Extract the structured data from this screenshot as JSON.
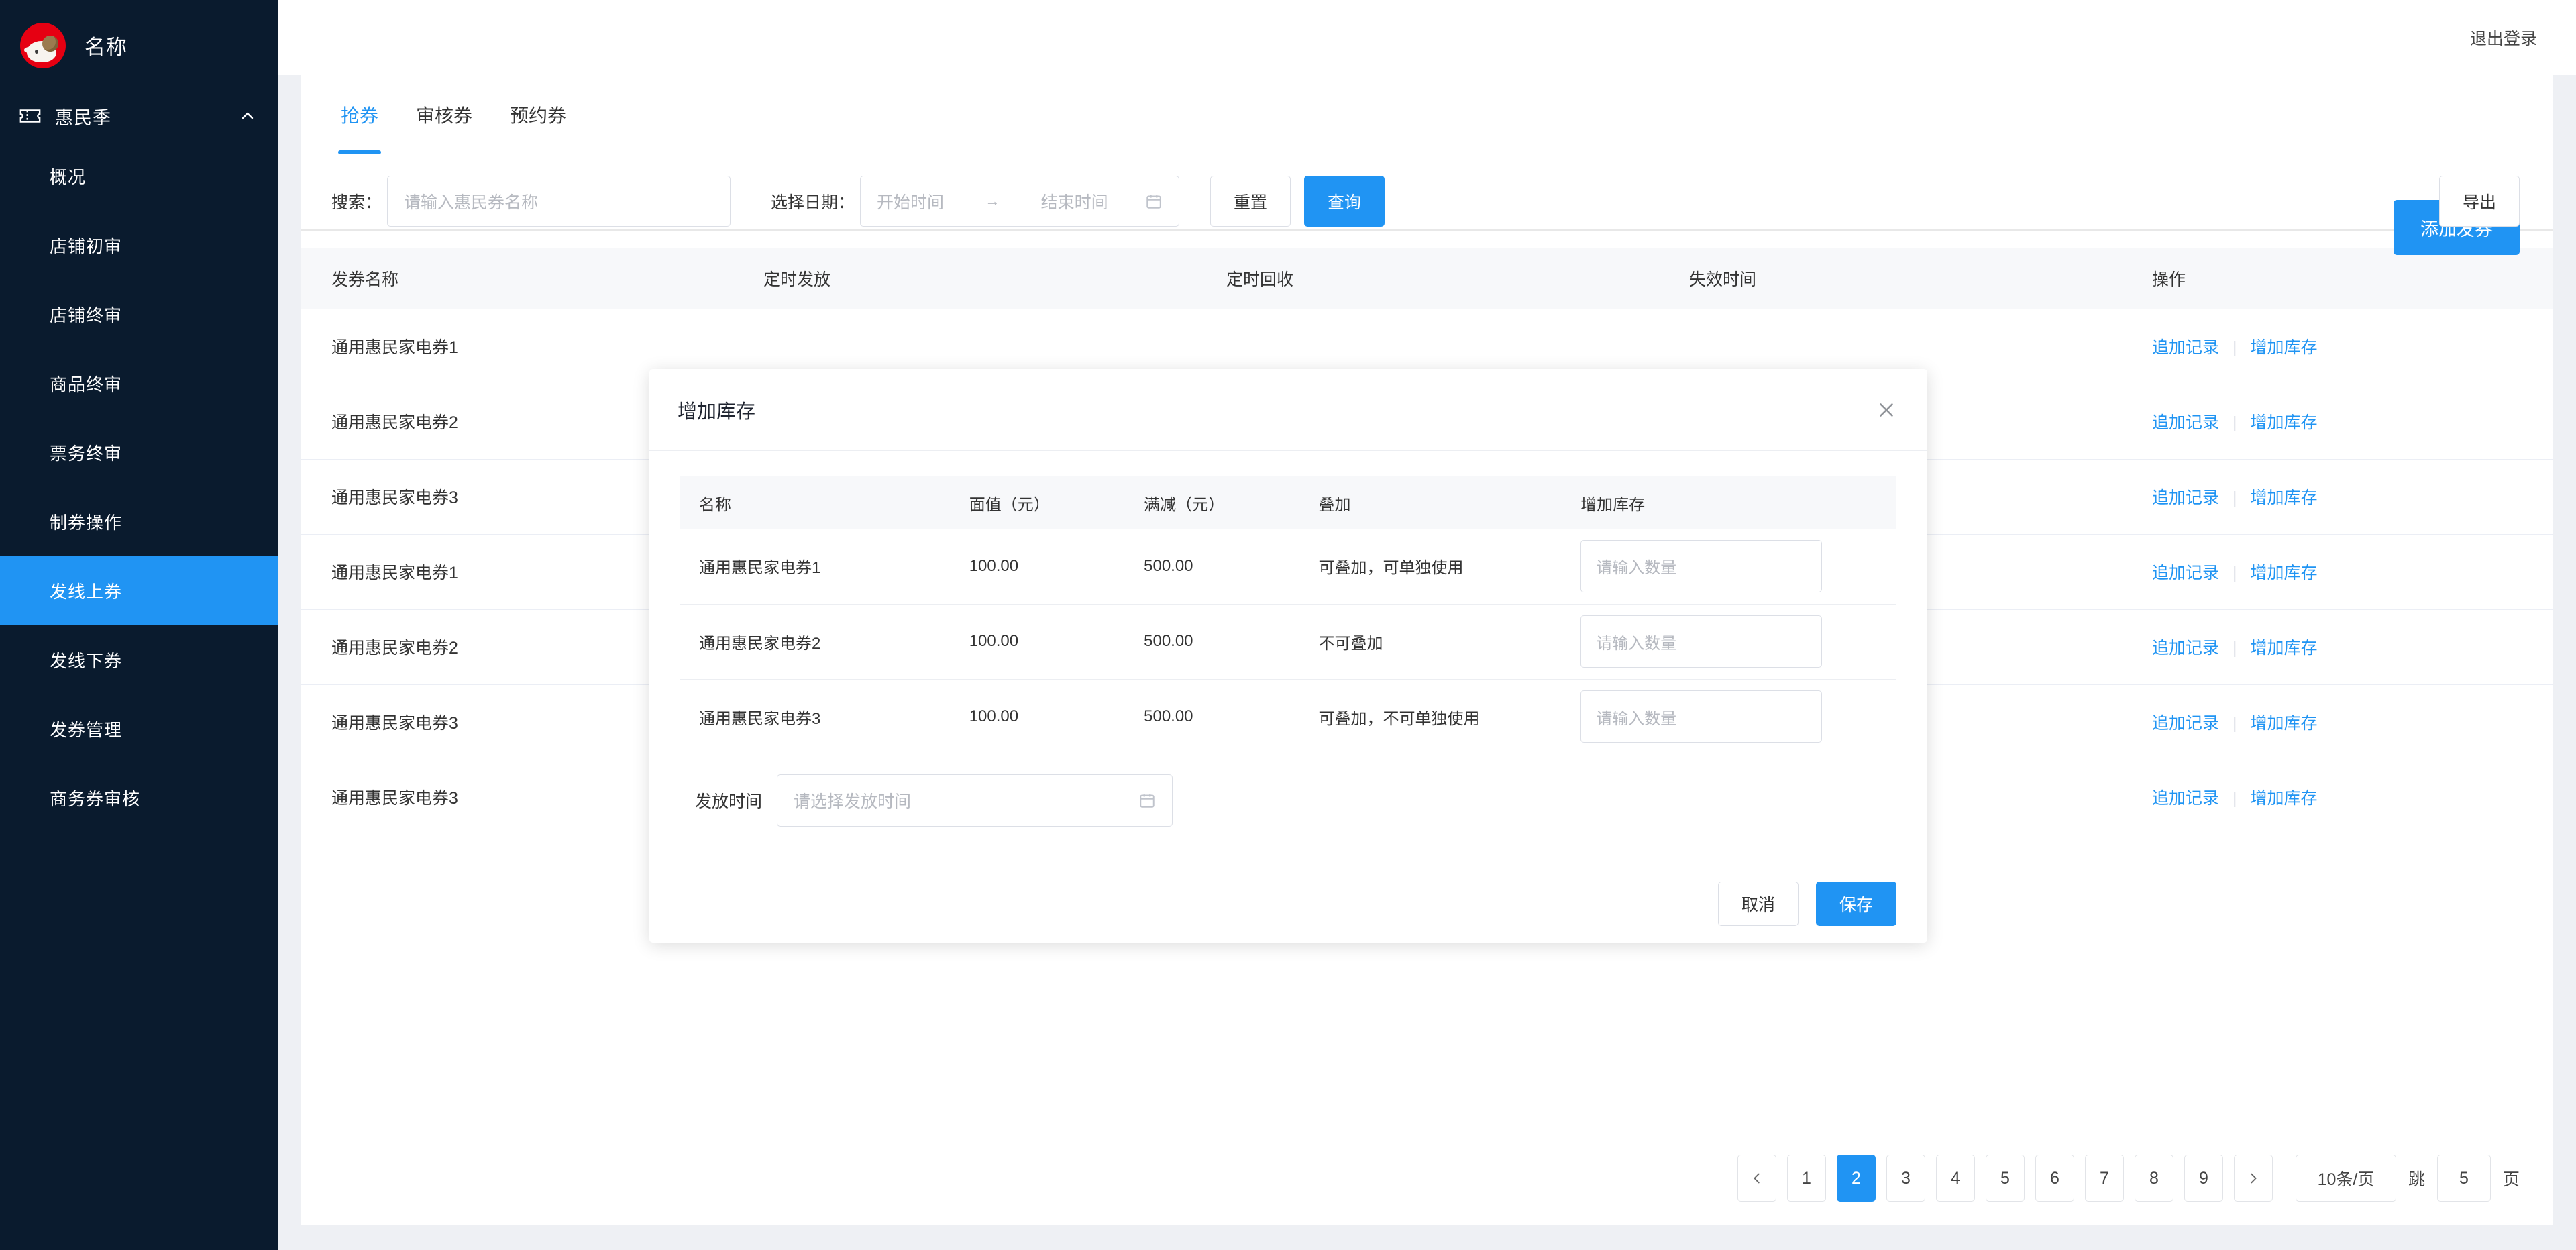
{
  "sidebar": {
    "brand_name": "名称",
    "brand_logo_icon": "ram-logo-icon",
    "group": {
      "label": "惠民季",
      "icon": "ticket-icon",
      "chevron": "chevron-up-icon",
      "expanded": true
    },
    "items": [
      {
        "label": "概况",
        "active": false
      },
      {
        "label": "店铺初审",
        "active": false
      },
      {
        "label": "店铺终审",
        "active": false
      },
      {
        "label": "商品终审",
        "active": false
      },
      {
        "label": "票务终审",
        "active": false
      },
      {
        "label": "制券操作",
        "active": false
      },
      {
        "label": "发线上券",
        "active": true
      },
      {
        "label": "发线下券",
        "active": false
      },
      {
        "label": "发券管理",
        "active": false
      },
      {
        "label": "商务券审核",
        "active": false
      }
    ],
    "active_color": "#2094f3",
    "bg_color": "#0a1b2e"
  },
  "header": {
    "logout_label": "退出登录"
  },
  "tabs": [
    {
      "label": "抢券",
      "active": true
    },
    {
      "label": "审核券",
      "active": false
    },
    {
      "label": "预约券",
      "active": false
    }
  ],
  "toolbar": {
    "add_label": "添加发券",
    "export_label": "导出",
    "search_label": "搜索：",
    "search_placeholder": "请输入惠民券名称",
    "search_value": "",
    "date_label": "选择日期：",
    "date_start_placeholder": "开始时间",
    "date_range_arrow": "→",
    "date_end_placeholder": "结束时间",
    "calendar_icon": "calendar-icon",
    "reset_label": "重置",
    "query_label": "查询"
  },
  "table": {
    "columns": [
      "发券名称",
      "定时发放",
      "定时回收",
      "失效时间",
      "操作"
    ],
    "action_append": "追加记录",
    "action_addstock": "增加库存",
    "rows": [
      {
        "name": "通用惠民家电券1",
        "send": "",
        "reclaim": "",
        "expire": ""
      },
      {
        "name": "通用惠民家电券2",
        "send": "",
        "reclaim": "",
        "expire": ""
      },
      {
        "name": "通用惠民家电券3",
        "send": "",
        "reclaim": "",
        "expire": ""
      },
      {
        "name": "通用惠民家电券1",
        "send": "",
        "reclaim": "",
        "expire": ""
      },
      {
        "name": "通用惠民家电券2",
        "send": "",
        "reclaim": "",
        "expire": ""
      },
      {
        "name": "通用惠民家电券3",
        "send": "",
        "reclaim": "",
        "expire": ""
      },
      {
        "name": "通用惠民家电券3",
        "send": "",
        "reclaim": "",
        "expire": ""
      }
    ]
  },
  "pagination": {
    "prev_icon": "chevron-left-icon",
    "next_icon": "chevron-right-icon",
    "pages": [
      "1",
      "2",
      "3",
      "4",
      "5",
      "6",
      "7",
      "8",
      "9"
    ],
    "current": "2",
    "page_size_label": "10条/页",
    "jump_label": "跳",
    "jump_value": "5",
    "page_unit": "页"
  },
  "modal": {
    "title": "增加库存",
    "close_icon": "close-icon",
    "columns": [
      "名称",
      "面值（元）",
      "满减（元）",
      "叠加",
      "增加库存"
    ],
    "rows": [
      {
        "name": "通用惠民家电券1",
        "face": "100.00",
        "threshold": "500.00",
        "stack": "可叠加，可单独使用",
        "qty_value": "",
        "qty_placeholder": "请输入数量"
      },
      {
        "name": "通用惠民家电券2",
        "face": "100.00",
        "threshold": "500.00",
        "stack": "不可叠加",
        "qty_value": "",
        "qty_placeholder": "请输入数量"
      },
      {
        "name": "通用惠民家电券3",
        "face": "100.00",
        "threshold": "500.00",
        "stack": "可叠加，不可单独使用",
        "qty_value": "",
        "qty_placeholder": "请输入数量"
      }
    ],
    "time_label": "发放时间",
    "time_placeholder": "请选择发放时间",
    "time_value": "",
    "time_icon": "calendar-icon",
    "cancel_label": "取消",
    "save_label": "保存"
  },
  "colors": {
    "accent": "#2094f3",
    "sidebar_bg": "#0a1b2e",
    "page_bg": "#eef0f4",
    "logo_red": "#e60012"
  }
}
